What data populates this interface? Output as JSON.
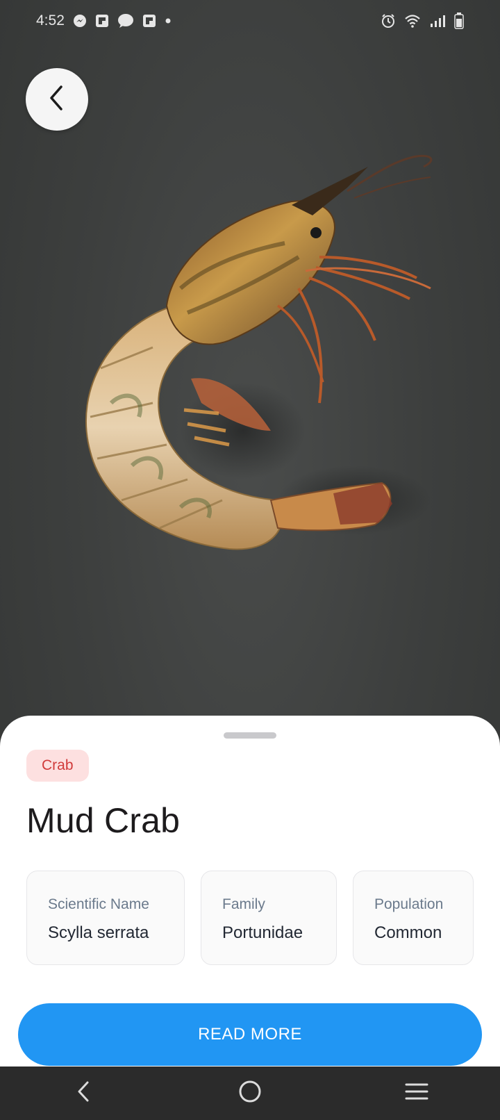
{
  "status_bar": {
    "time": "4:52",
    "left_icons": [
      "messenger-icon",
      "flipboard-icon",
      "chat-bubble-icon",
      "flipboard-icon",
      "dot-icon"
    ],
    "right_icons": [
      "alarm-icon",
      "wifi-icon",
      "signal-icon",
      "battery-icon"
    ]
  },
  "header": {
    "back_icon": "chevron-left-icon"
  },
  "species": {
    "category": "Crab",
    "name": "Mud Crab",
    "facts": [
      {
        "label": "Scientific Name",
        "value": "Scylla serrata"
      },
      {
        "label": "Family",
        "value": "Portunidae"
      },
      {
        "label": "Population",
        "value": "Common"
      }
    ]
  },
  "actions": {
    "read_more_label": "READ MORE"
  },
  "nav_bar": {
    "icons": [
      "back-icon",
      "home-icon",
      "recents-icon"
    ]
  },
  "colors": {
    "accent": "#2196f3",
    "chip_bg": "#fde0e0",
    "chip_text": "#d13b3b",
    "background": "#3d3f3e"
  }
}
